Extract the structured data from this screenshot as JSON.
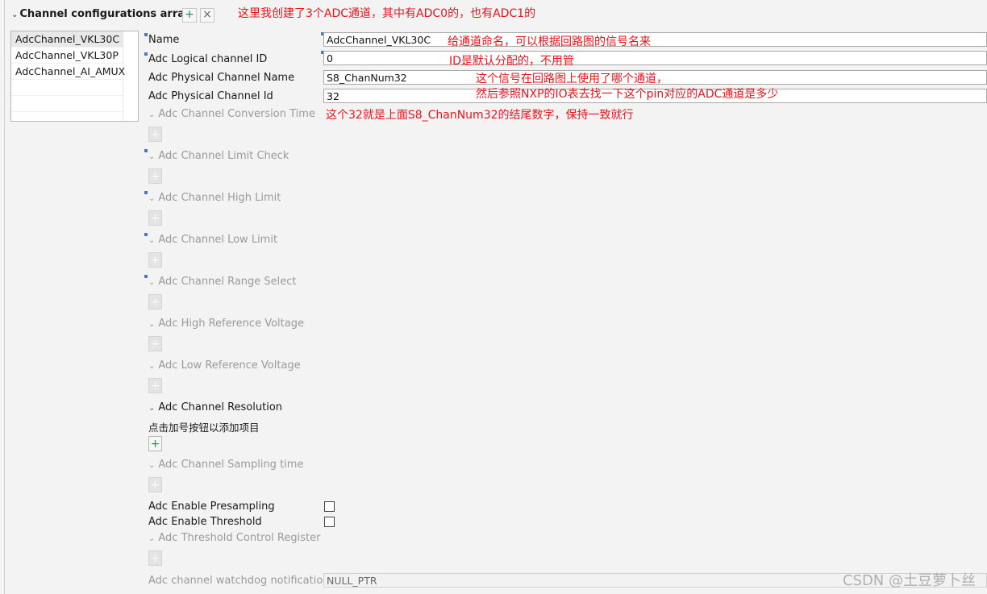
{
  "section": {
    "title": "Channel configurations array",
    "add_label": "+",
    "remove_label": "×"
  },
  "channels": [
    {
      "label": "AdcChannel_VKL30C",
      "selected": true
    },
    {
      "label": "AdcChannel_VKL30P",
      "selected": false
    },
    {
      "label": "AdcChannel_AI_AMUX",
      "selected": false
    }
  ],
  "fields": {
    "name": {
      "label": "Name",
      "value": "AdcChannel_VKL30C"
    },
    "logical_id": {
      "label": "Adc Logical channel ID",
      "value": "0"
    },
    "physical_name": {
      "label": "Adc Physical Channel Name",
      "value": "S8_ChanNum32"
    },
    "physical_id": {
      "label": "Adc Physical Channel Id",
      "value": "32"
    }
  },
  "optional": {
    "conversion_time": "Adc Channel Conversion Time",
    "limit_check": "Adc Channel Limit Check",
    "high_limit": "Adc Channel High Limit",
    "low_limit": "Adc Channel Low Limit",
    "range_select": "Adc Channel Range Select",
    "high_ref": "Adc High Reference Voltage",
    "low_ref": "Adc Low Reference Voltage",
    "resolution": "Adc Channel Resolution",
    "resolution_hint": "点击加号按钮以添加项目",
    "sampling_time": "Adc Channel Sampling time",
    "threshold_reg": "Adc Threshold Control Register"
  },
  "add_button_label": "+",
  "checkboxes": {
    "presampling": {
      "label": "Adc Enable Presampling",
      "checked": false
    },
    "threshold": {
      "label": "Adc Enable Threshold",
      "checked": false
    }
  },
  "watchdog": {
    "label": "Adc channel watchdog notification",
    "value": "NULL_PTR"
  },
  "annotations": {
    "top": "这里我创建了3个ADC通道，其中有ADC0的，也有ADC1的",
    "name": "给通道命名，可以根据回路图的信号名来",
    "id": "ID是默认分配的，不用管",
    "signal_1": "这个信号在回路图上使用了哪个通道，",
    "signal_2": "然后参照NXP的IO表去找一下这个pin对应的ADC通道是多少",
    "num": "这个32就是上面S8_ChanNum32的结尾数字，保持一致就行"
  },
  "watermark": "CSDN @土豆萝卜丝",
  "colors": {
    "annotation": "#e8141b",
    "accent": "#2e8b57",
    "marker": "#4a78c2"
  }
}
